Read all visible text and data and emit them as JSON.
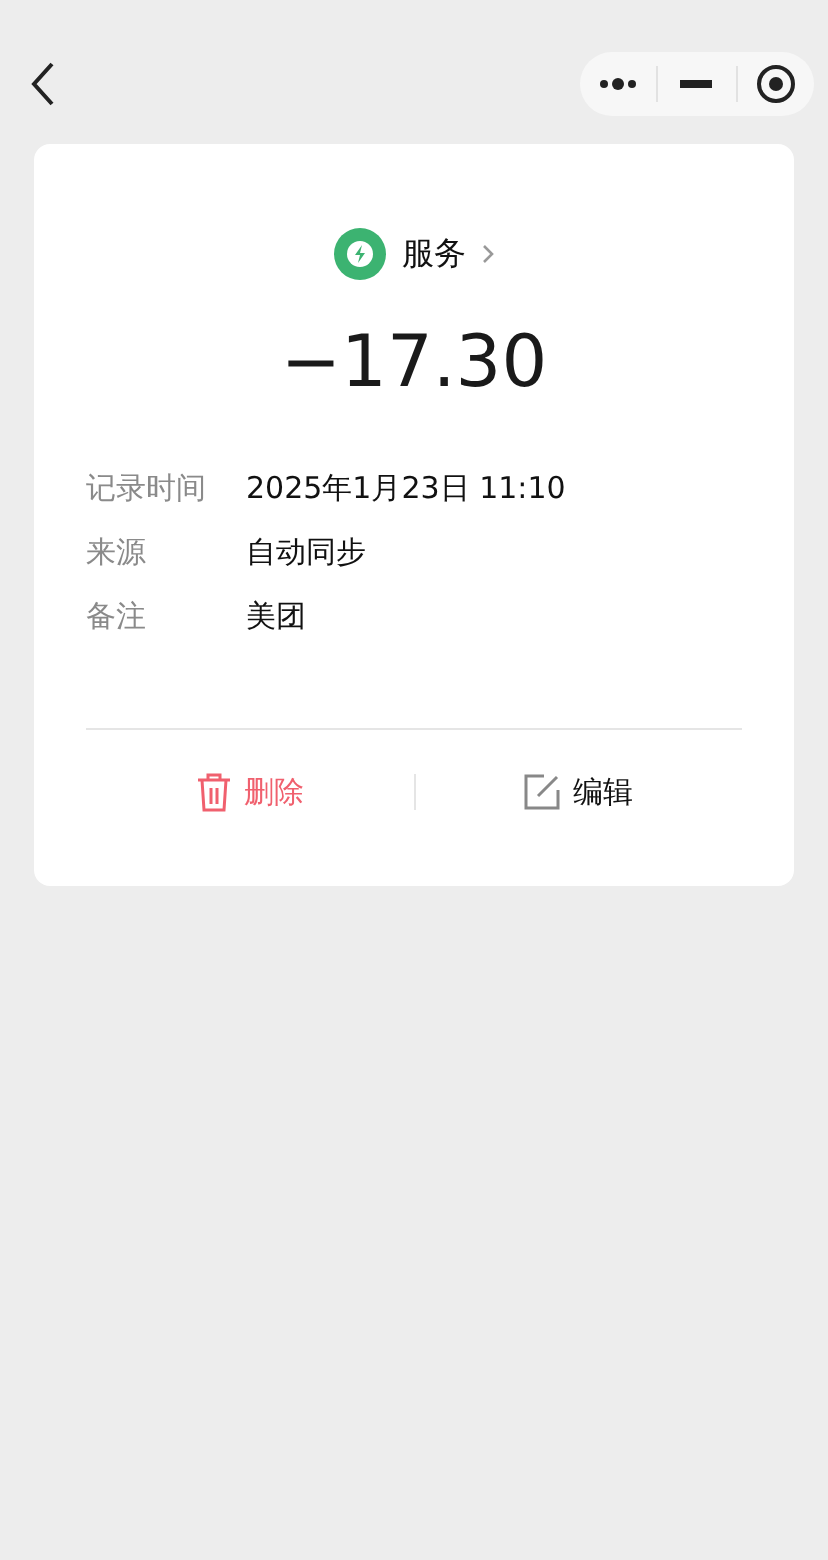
{
  "category": {
    "name": "服务",
    "color": "#3cb371"
  },
  "amount": "−17.30",
  "details": [
    {
      "label": "记录时间",
      "value": "2025年1月23日 11:10"
    },
    {
      "label": "来源",
      "value": "自动同步"
    },
    {
      "label": "备注",
      "value": "美团"
    }
  ],
  "actions": [
    {
      "kind": "delete",
      "label": "删除"
    },
    {
      "kind": "edit",
      "label": "编辑"
    }
  ]
}
